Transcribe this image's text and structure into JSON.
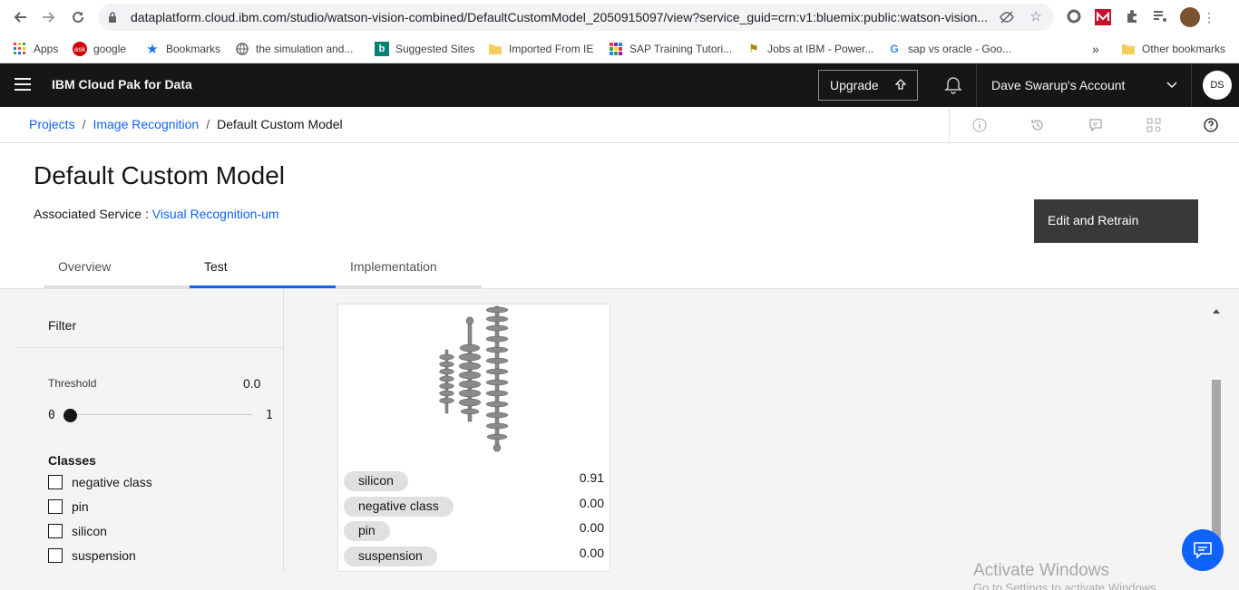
{
  "browser": {
    "url": "dataplatform.cloud.ibm.com/studio/watson-vision-combined/DefaultCustomModel_2050915097/view?service_guid=crn:v1:bluemix:public:watson-vision...",
    "bookmarks": [
      {
        "label": "Apps",
        "icon": "apps-grid-icon"
      },
      {
        "label": "google",
        "icon": "google-favicon-icon"
      },
      {
        "label": "Bookmarks",
        "icon": "star-icon"
      },
      {
        "label": "the simulation and...",
        "icon": "globe-icon"
      },
      {
        "label": "Suggested Sites",
        "icon": "bing-icon"
      },
      {
        "label": "Imported From IE",
        "icon": "folder-icon"
      },
      {
        "label": "SAP Training Tutori...",
        "icon": "grid-favicon-icon"
      },
      {
        "label": "Jobs at IBM - Power...",
        "icon": "jobs-favicon-icon"
      },
      {
        "label": "sap vs oracle - Goo...",
        "icon": "google-g-icon"
      }
    ],
    "more_bookmarks": "»",
    "other_bookmarks": "Other bookmarks"
  },
  "header": {
    "brand": "IBM Cloud Pak for Data",
    "upgrade_label": "Upgrade",
    "account_name": "Dave Swarup's Account",
    "avatar_initials": "DS"
  },
  "breadcrumb": {
    "items": [
      "Projects",
      "Image Recognition",
      "Default Custom Model"
    ],
    "separator": "/"
  },
  "page": {
    "title": "Default Custom Model",
    "associated_label": "Associated Service :",
    "associated_service": "Visual Recognition-um",
    "retrain_button": "Edit and Retrain"
  },
  "tabs": [
    {
      "label": "Overview",
      "active": false
    },
    {
      "label": "Test",
      "active": true
    },
    {
      "label": "Implementation",
      "active": false
    }
  ],
  "filter": {
    "title": "Filter",
    "threshold_label": "Threshold",
    "threshold_value": "0.0",
    "slider_min": "0",
    "slider_max": "1",
    "classes_title": "Classes",
    "classes": [
      "negative class",
      "pin",
      "silicon",
      "suspension"
    ]
  },
  "result_card": {
    "scores": [
      {
        "class": "silicon",
        "score": "0.91"
      },
      {
        "class": "negative class",
        "score": "0.00"
      },
      {
        "class": "pin",
        "score": "0.00"
      },
      {
        "class": "suspension",
        "score": "0.00"
      }
    ]
  },
  "watermark": {
    "line1": "Activate Windows",
    "line2": "Go to Settings to activate Windows."
  },
  "colors": {
    "accent": "#0f62fe",
    "header_bg": "#161616",
    "content_bg": "#f4f4f4"
  }
}
